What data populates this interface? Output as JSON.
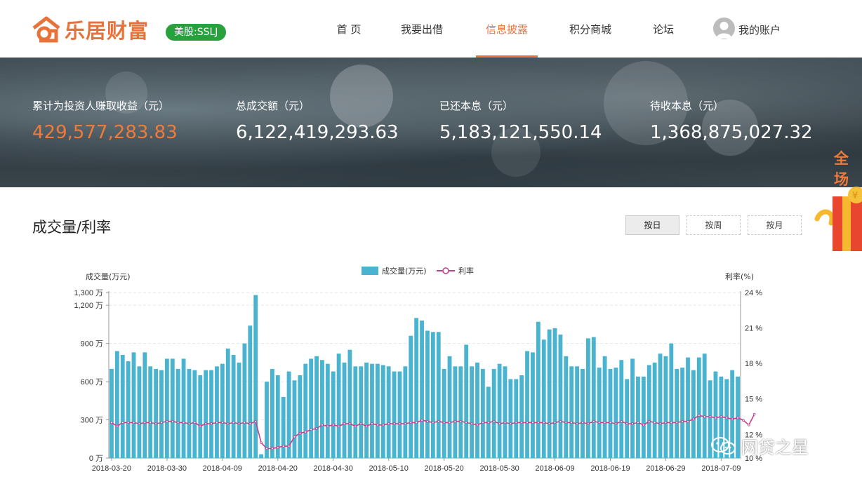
{
  "header": {
    "logo_text": "乐居财富",
    "stock_badge": "美股:SSLJ",
    "nav": [
      {
        "label": "首 页",
        "active": false
      },
      {
        "label": "我要出借",
        "active": false
      },
      {
        "label": "信息披露",
        "active": true
      },
      {
        "label": "积分商城",
        "active": false
      },
      {
        "label": "论坛",
        "active": false
      }
    ],
    "account_label": "我的账户"
  },
  "stats": [
    {
      "label": "累计为投资人赚取收益（元）",
      "value": "429,577,283.83"
    },
    {
      "label": "总成交额（元）",
      "value": "6,122,419,293.63"
    },
    {
      "label": "已还本息（元）",
      "value": "5,183,121,550.14"
    },
    {
      "label": "待收本息（元）",
      "value": "1,368,875,027.32"
    }
  ],
  "promo_text": "全场",
  "section_title": "成交量/利率",
  "period_buttons": [
    {
      "label": "按日",
      "selected": true
    },
    {
      "label": "按周",
      "selected": false
    },
    {
      "label": "按月",
      "selected": false
    }
  ],
  "watermark": "网贷之星",
  "colors": {
    "accent": "#e8733a",
    "badge": "#27a13b",
    "bar": "#4ab4d0",
    "line": "#c43f8a"
  },
  "chart_data": {
    "type": "bar",
    "legend": [
      "成交量(万元)",
      "利率"
    ],
    "legend_position": "top-center",
    "y_left_label": "成交量(万元)",
    "y_right_label": "利率(%)",
    "y_left_ticks": [
      "0 万",
      "300 万",
      "600 万",
      "900 万",
      "1,200 万",
      "1,300 万"
    ],
    "y_left_tick_values": [
      0,
      300,
      600,
      900,
      1200,
      1300
    ],
    "y_right_ticks": [
      "10 %",
      "12 %",
      "15 %",
      "18 %",
      "21 %",
      "24 %"
    ],
    "y_right_tick_values": [
      10,
      12,
      15,
      18,
      21,
      24
    ],
    "ylim_left": [
      0,
      1300
    ],
    "ylim_right": [
      10,
      24
    ],
    "x_tick_labels": [
      "2018-03-20",
      "2018-03-30",
      "2018-04-09",
      "2018-04-20",
      "2018-04-30",
      "2018-05-10",
      "2018-05-20",
      "2018-05-30",
      "2018-06-09",
      "2018-06-19",
      "2018-06-29",
      "2018-07-09"
    ],
    "grid": true,
    "series": [
      {
        "name": "成交量(万元)",
        "values": [
          700,
          840,
          810,
          760,
          830,
          720,
          830,
          720,
          700,
          690,
          780,
          780,
          700,
          780,
          700,
          690,
          650,
          690,
          690,
          720,
          740,
          860,
          810,
          750,
          900,
          1040,
          1280,
          30,
          600,
          700,
          650,
          480,
          680,
          610,
          650,
          740,
          780,
          800,
          770,
          740,
          680,
          820,
          750,
          850,
          720,
          720,
          750,
          740,
          740,
          730,
          720,
          680,
          680,
          720,
          960,
          1100,
          1080,
          1000,
          990,
          990,
          700,
          800,
          720,
          720,
          890,
          720,
          750,
          700,
          560,
          700,
          740,
          720,
          620,
          620,
          650,
          840,
          830,
          1070,
          930,
          1010,
          1020,
          970,
          800,
          720,
          720,
          700,
          940,
          950,
          710,
          800,
          700,
          710,
          770,
          620,
          780,
          640,
          640,
          730,
          750,
          820,
          800,
          900,
          700,
          710,
          790,
          690,
          790,
          820,
          610,
          680,
          640,
          620,
          690,
          640
        ],
        "rate": [
          13.0,
          12.7,
          13.0,
          13.0,
          13.0,
          12.9,
          13.0,
          13.0,
          12.9,
          13.0,
          13.1,
          13.1,
          13.0,
          13.0,
          12.9,
          13.0,
          12.7,
          12.9,
          12.9,
          13.0,
          13.0,
          12.9,
          13.0,
          12.9,
          13.0,
          12.9,
          13.1,
          11.3,
          10.8,
          10.8,
          10.9,
          11.0,
          11.0,
          11.8,
          12.1,
          12.2,
          12.4,
          12.5,
          12.8,
          12.7,
          12.8,
          12.7,
          12.9,
          12.9,
          12.7,
          12.9,
          12.7,
          12.9,
          12.8,
          12.8,
          12.9,
          12.9,
          12.9,
          12.9,
          13.0,
          13.0,
          13.2,
          13.1,
          13.0,
          13.1,
          13.0,
          13.0,
          13.1,
          13.1,
          13.0,
          12.9,
          12.8,
          13.0,
          13.0,
          13.1,
          12.9,
          13.0,
          12.9,
          13.0,
          13.0,
          13.0,
          13.0,
          13.0,
          13.0,
          12.9,
          13.0,
          13.1,
          13.0,
          13.0,
          12.9,
          13.0,
          12.9,
          13.1,
          13.0,
          13.0,
          13.0,
          12.9,
          13.1,
          12.9,
          12.9,
          13.0,
          12.8,
          13.1,
          13.0,
          12.9,
          13.0,
          13.0,
          13.0,
          13.1,
          13.1,
          13.3,
          13.6,
          13.5,
          13.5,
          13.4,
          13.5,
          13.4,
          13.3,
          13.4,
          13.2,
          12.8,
          13.7
        ]
      }
    ]
  }
}
